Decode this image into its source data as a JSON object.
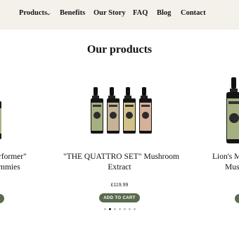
{
  "nav": {
    "items": [
      {
        "label": "Products"
      },
      {
        "label": "Benefits"
      },
      {
        "label": "Our Story"
      },
      {
        "label": "FAQ"
      },
      {
        "label": "Blog"
      },
      {
        "label": "Contact"
      }
    ]
  },
  "section": {
    "title": "Our products"
  },
  "cards": [
    {
      "name_line1": "rformer\"",
      "name_line2": "mmies"
    },
    {
      "name_line1": "\"THE QUATTRO SET\" Mushroom",
      "name_line2": "Extract",
      "price": "£119.99",
      "cta": "ADD TO CART"
    },
    {
      "name_line1": "Lion's M",
      "name_line2": "Mus"
    }
  ],
  "carousel": {
    "dot_count": 7,
    "active_index": 1
  },
  "colors": {
    "nav_bg": "#f4f0ea",
    "button": "#5a6b4f",
    "label_green": "#9aa77a"
  }
}
